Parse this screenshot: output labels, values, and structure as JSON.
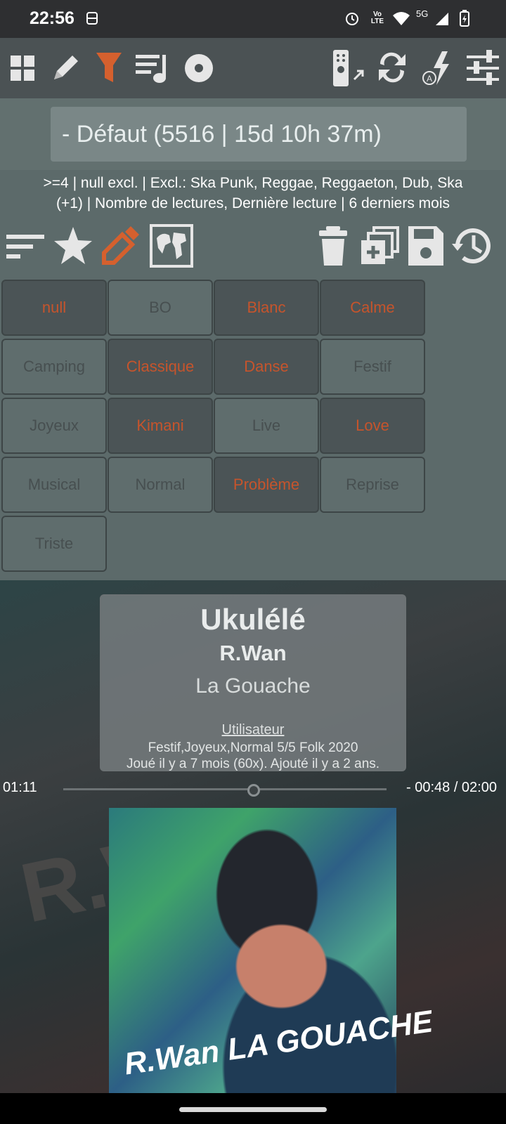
{
  "status_bar": {
    "time": "22:56",
    "network": "5G"
  },
  "toolbar": {
    "icons": [
      "grid-icon",
      "pencil-icon",
      "filter-icon",
      "playlist-icon",
      "disc-icon",
      "remote-icon",
      "sync-icon",
      "auto-flash-icon",
      "equalizer-icon"
    ]
  },
  "filter": {
    "name": "- Défaut (5516 | 15d 10h 37m)",
    "summary_line1": ">=4 | null excl. | Excl.: Ska Punk, Reggae, Reggaeton, Dub, Ska",
    "summary_line2": "(+1) | Nombre de lectures, Dernière lecture | 6 derniers mois"
  },
  "actions": {
    "icons": [
      "sort-icon",
      "star-icon",
      "edit-tag-icon",
      "map-icon",
      "trash-icon",
      "duplicate-icon",
      "save-icon",
      "history-icon"
    ]
  },
  "tags": [
    {
      "label": "null",
      "active": true
    },
    {
      "label": "BO",
      "active": false
    },
    {
      "label": "Blanc",
      "active": true
    },
    {
      "label": "Calme",
      "active": true
    },
    {
      "label": "Camping",
      "active": false
    },
    {
      "label": "Classique",
      "active": true
    },
    {
      "label": "Danse",
      "active": true
    },
    {
      "label": "Festif",
      "active": false
    },
    {
      "label": "Joyeux",
      "active": false
    },
    {
      "label": "Kimani",
      "active": true
    },
    {
      "label": "Live",
      "active": false
    },
    {
      "label": "Love",
      "active": true
    },
    {
      "label": "Musical",
      "active": false
    },
    {
      "label": "Normal",
      "active": false
    },
    {
      "label": "Problème",
      "active": true
    },
    {
      "label": "Reprise",
      "active": false
    },
    {
      "label": "Triste",
      "active": false
    }
  ],
  "player": {
    "title": "Ukulélé",
    "artist": "R.Wan",
    "album": "La Gouache",
    "user_label": "Utilisateur",
    "tags_line": "Festif,Joyeux,Normal 5/5 Folk 2020",
    "played_line": "Joué il y a 7 mois (60x). Ajouté il y a 2 ans.",
    "elapsed": "01:11",
    "remaining": "- 00:48 / 02:00",
    "progress_fraction": 0.59,
    "cover_logo": "R.Wan LA GOUACHE"
  },
  "colors": {
    "active_tag": "#c6542c",
    "panel": "#5c6a6a"
  }
}
